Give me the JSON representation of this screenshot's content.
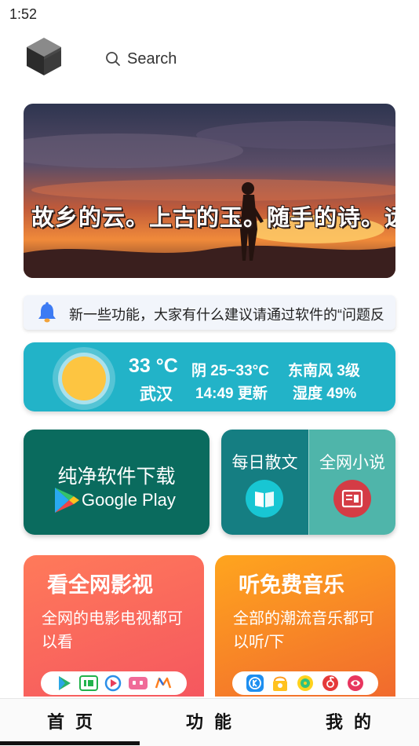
{
  "status_bar": {
    "time": "1:52"
  },
  "header": {
    "logo_icon": "cube-logo-icon",
    "search_icon": "search-icon",
    "search_label": "Search"
  },
  "banner": {
    "text": "故乡的云。上古的玉。随手的诗。远方的你"
  },
  "notice": {
    "icon": "bell-icon",
    "text": "新一些功能，大家有什么建议请通过软件的“问题反"
  },
  "weather": {
    "icon": "sun-icon",
    "temperature": "33 °C",
    "city": "武汉",
    "condition": "阴 25~33°C",
    "update_time": "14:49 更新",
    "wind": "东南风 3级",
    "humidity": "湿度 49%"
  },
  "google_play_card": {
    "title": "纯净软件下载",
    "icon": "google-play-icon",
    "label": "Google Play"
  },
  "reading_cards": [
    {
      "title": "每日散文",
      "icon": "book-icon"
    },
    {
      "title": "全网小说",
      "icon": "reader-icon"
    }
  ],
  "promos": [
    {
      "title": "看全网影视",
      "desc": "全网的电影电视都可以看",
      "apps": [
        "play-icon",
        "iqiyi-icon",
        "youku-icon",
        "bilibili-icon",
        "mango-icon"
      ]
    },
    {
      "title": "听免费音乐",
      "desc": "全部的潮流音乐都可以听/下",
      "apps": [
        "kugou-icon",
        "kuwo-icon",
        "qqmusic-icon",
        "netease-icon",
        "migu-icon"
      ]
    }
  ],
  "tabs": [
    {
      "label": "首页"
    },
    {
      "label": "功能"
    },
    {
      "label": "我的"
    }
  ],
  "colors": {
    "weather_bg": "#22b3c8",
    "google_play_bg": "#0a6b5e",
    "essay_bg": "#157e82",
    "novel_bg": "#4fb5aa",
    "video_gradient": "#ff7a5a",
    "music_gradient": "#ffa51e"
  }
}
